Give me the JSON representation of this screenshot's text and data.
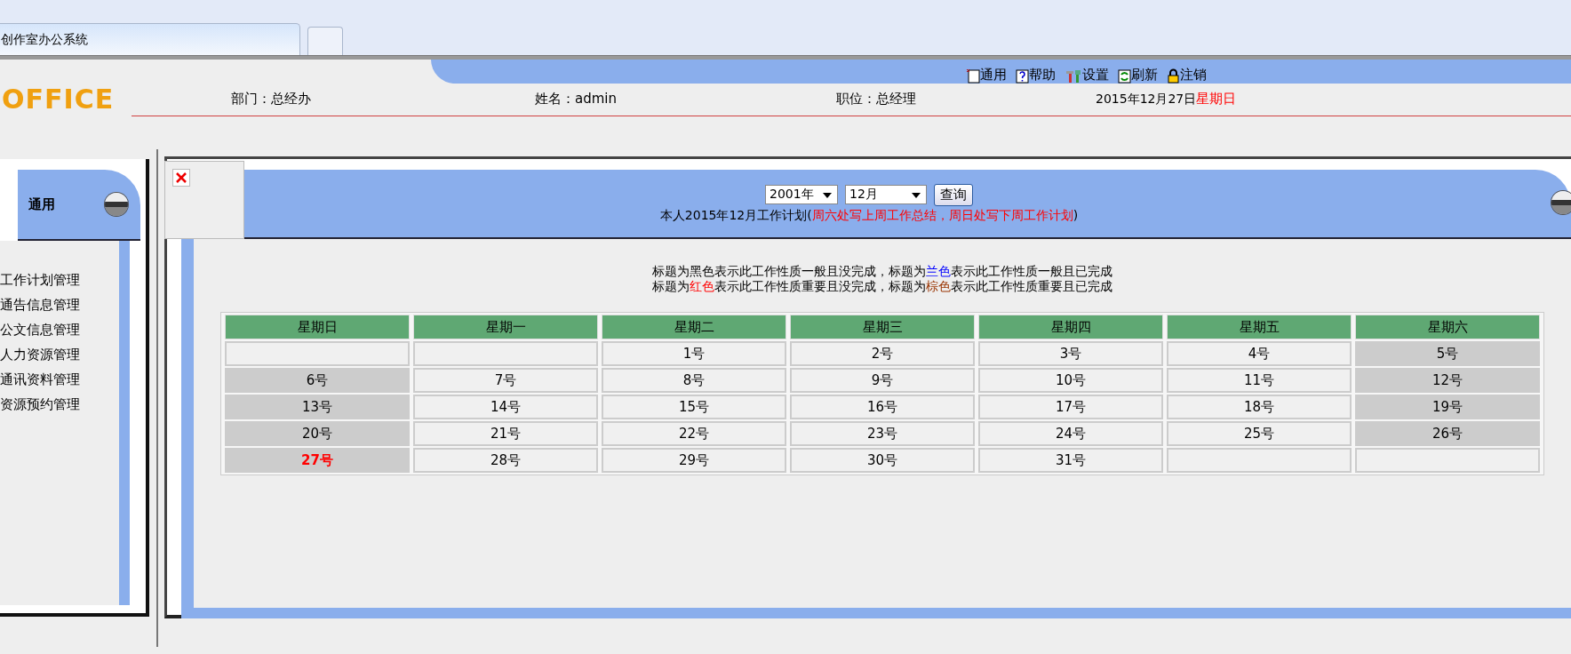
{
  "browser": {
    "tab_title": "创作室办公系统"
  },
  "header": {
    "logo": "OFFICE",
    "toolbar": [
      {
        "kind": "note",
        "label": "通用"
      },
      {
        "kind": "help",
        "label": "帮助"
      },
      {
        "kind": "tools",
        "label": "设置"
      },
      {
        "kind": "refresh",
        "label": "刷新"
      },
      {
        "kind": "lock",
        "label": "注销"
      }
    ],
    "department": "部门：总经办",
    "name": "姓名：admin",
    "position": "职位：总经理",
    "date": "2015年12月27日",
    "weekday": "星期日"
  },
  "sidebar": {
    "title": "通用",
    "items": [
      "工作计划管理",
      "通告信息管理",
      "公文信息管理",
      "人力资源管理",
      "通讯资料管理",
      "资源预约管理"
    ]
  },
  "plan": {
    "year": "2001年",
    "month": "12月",
    "query_button": "查询",
    "title": [
      {
        "text": "本人2015年12月工作计划("
      },
      {
        "text": "周六处写上周工作总结，周日处写下周工作计划",
        "color": "#ff0000"
      },
      {
        "text": ")"
      }
    ],
    "legend": [
      [
        {
          "text": "标题为黑色表示此工作性质一般且没完成，标题为"
        },
        {
          "text": "兰色",
          "color": "#0000ff"
        },
        {
          "text": "表示此工作性质一般且已完成"
        }
      ],
      [
        {
          "text": "标题为"
        },
        {
          "text": "红色",
          "color": "#ff0000"
        },
        {
          "text": "表示此工作性质重要且没完成，标题为"
        },
        {
          "text": "棕色",
          "color": "#993300"
        },
        {
          "text": "表示此工作性质重要且已完成"
        }
      ]
    ],
    "weekdays": [
      "星期日",
      "星期一",
      "星期二",
      "星期三",
      "星期四",
      "星期五",
      "星期六"
    ],
    "weeks": [
      [
        {
          "shaded": false
        },
        {
          "shaded": false
        },
        {
          "day": "1号",
          "shaded": false,
          "today": false
        },
        {
          "day": "2号",
          "shaded": false,
          "today": false
        },
        {
          "day": "3号",
          "shaded": false,
          "today": false
        },
        {
          "day": "4号",
          "shaded": false,
          "today": false
        },
        {
          "day": "5号",
          "shaded": true,
          "today": false
        }
      ],
      [
        {
          "day": "6号",
          "shaded": true,
          "today": false
        },
        {
          "day": "7号",
          "shaded": false,
          "today": false
        },
        {
          "day": "8号",
          "shaded": false,
          "today": false
        },
        {
          "day": "9号",
          "shaded": false,
          "today": false
        },
        {
          "day": "10号",
          "shaded": false,
          "today": false
        },
        {
          "day": "11号",
          "shaded": false,
          "today": false
        },
        {
          "day": "12号",
          "shaded": true,
          "today": false
        }
      ],
      [
        {
          "day": "13号",
          "shaded": true,
          "today": false
        },
        {
          "day": "14号",
          "shaded": false,
          "today": false
        },
        {
          "day": "15号",
          "shaded": false,
          "today": false
        },
        {
          "day": "16号",
          "shaded": false,
          "today": false
        },
        {
          "day": "17号",
          "shaded": false,
          "today": false
        },
        {
          "day": "18号",
          "shaded": false,
          "today": false
        },
        {
          "day": "19号",
          "shaded": true,
          "today": false
        }
      ],
      [
        {
          "day": "20号",
          "shaded": true,
          "today": false
        },
        {
          "day": "21号",
          "shaded": false,
          "today": false
        },
        {
          "day": "22号",
          "shaded": false,
          "today": false
        },
        {
          "day": "23号",
          "shaded": false,
          "today": false
        },
        {
          "day": "24号",
          "shaded": false,
          "today": false
        },
        {
          "day": "25号",
          "shaded": false,
          "today": false
        },
        {
          "day": "26号",
          "shaded": true,
          "today": false
        }
      ],
      [
        {
          "day": "27号",
          "shaded": true,
          "today": true
        },
        {
          "day": "28号",
          "shaded": false,
          "today": false
        },
        {
          "day": "29号",
          "shaded": false,
          "today": false
        },
        {
          "day": "30号",
          "shaded": false,
          "today": false
        },
        {
          "day": "31号",
          "shaded": false,
          "today": false
        },
        {
          "shaded": false
        },
        {
          "shaded": false
        }
      ]
    ]
  }
}
